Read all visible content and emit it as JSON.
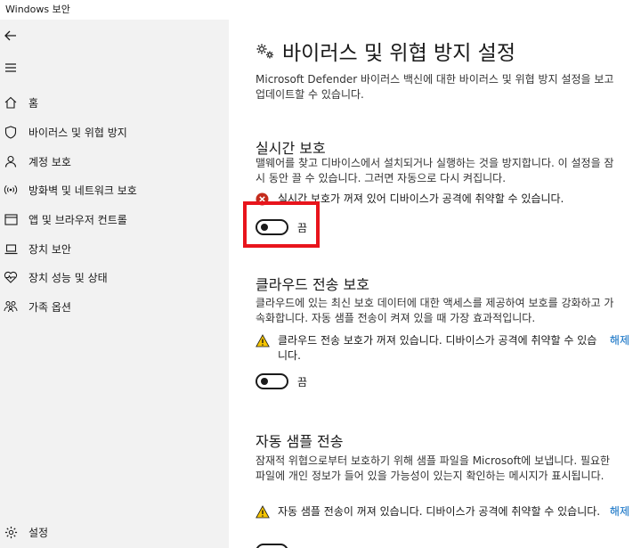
{
  "window": {
    "title": "Windows 보안"
  },
  "sidebar": {
    "back_icon": "arrow-left-icon",
    "menu_icon": "hamburger-menu-icon",
    "items": [
      {
        "label": "홈",
        "icon": "home-icon"
      },
      {
        "label": "바이러스 및 위협 방지",
        "icon": "shield-icon"
      },
      {
        "label": "계정 보호",
        "icon": "person-icon"
      },
      {
        "label": "방화벽 및 네트워크 보호",
        "icon": "wireless-signal-icon"
      },
      {
        "label": "앱 및 브라우저 컨트롤",
        "icon": "browser-window-icon"
      },
      {
        "label": "장치 보안",
        "icon": "laptop-icon"
      },
      {
        "label": "장치 성능 및 상태",
        "icon": "heart-pulse-icon"
      },
      {
        "label": "가족 옵션",
        "icon": "family-icon"
      }
    ],
    "settings_label": "설정"
  },
  "main": {
    "title": "바이러스 및 위협 방지 설정",
    "title_icon": "gears-icon",
    "description": "Microsoft Defender 바이러스 백신에 대한 바이러스 및 위협 방지 설정을 보고 업데이트할 수 있습니다.",
    "sections": [
      {
        "title": "실시간 보호",
        "description": "맬웨어를 찾고 디바이스에서 설치되거나 실행하는 것을 방지합니다. 이 설정을 잠시 동안 끌 수 있습니다. 그러면 자동으로 다시 켜집니다.",
        "status_icon": "error-circle-icon",
        "status": "실시간 보호가 꺼져 있어 디바이스가 공격에 취약할 수 있습니다.",
        "toggle_label": "끔",
        "toggle_on": false
      },
      {
        "title": "클라우드 전송 보호",
        "description": "클라우드에 있는 최신 보호 데이터에 대한 액세스를 제공하여 보호를 강화하고 가속화합니다. 자동 샘플 전송이 켜져 있을 때 가장 효과적입니다.",
        "status_icon": "warning-triangle-icon",
        "status": "클라우드 전송 보호가 꺼져 있습니다. 디바이스가 공격에 취약할 수 있습니다.",
        "dismiss_label": "해제",
        "toggle_label": "끔",
        "toggle_on": false
      },
      {
        "title": "자동 샘플 전송",
        "description": "잠재적 위협으로부터 보호하기 위해 샘플 파일을 Microsoft에 보냅니다. 필요한 파일에 개인 정보가 들어 있을 가능성이 있는지 확인하는 메시지가 표시됩니다.",
        "status_icon": "warning-triangle-icon",
        "status": "자동 샘플 전송이 꺼져 있습니다. 디바이스가 공격에 취약할 수 있습니다.",
        "dismiss_label": "해제"
      }
    ]
  },
  "colors": {
    "accent_link": "#0067c0",
    "highlight": "#e8141c",
    "error": "#c42b1c",
    "warning": "#f5c400"
  }
}
